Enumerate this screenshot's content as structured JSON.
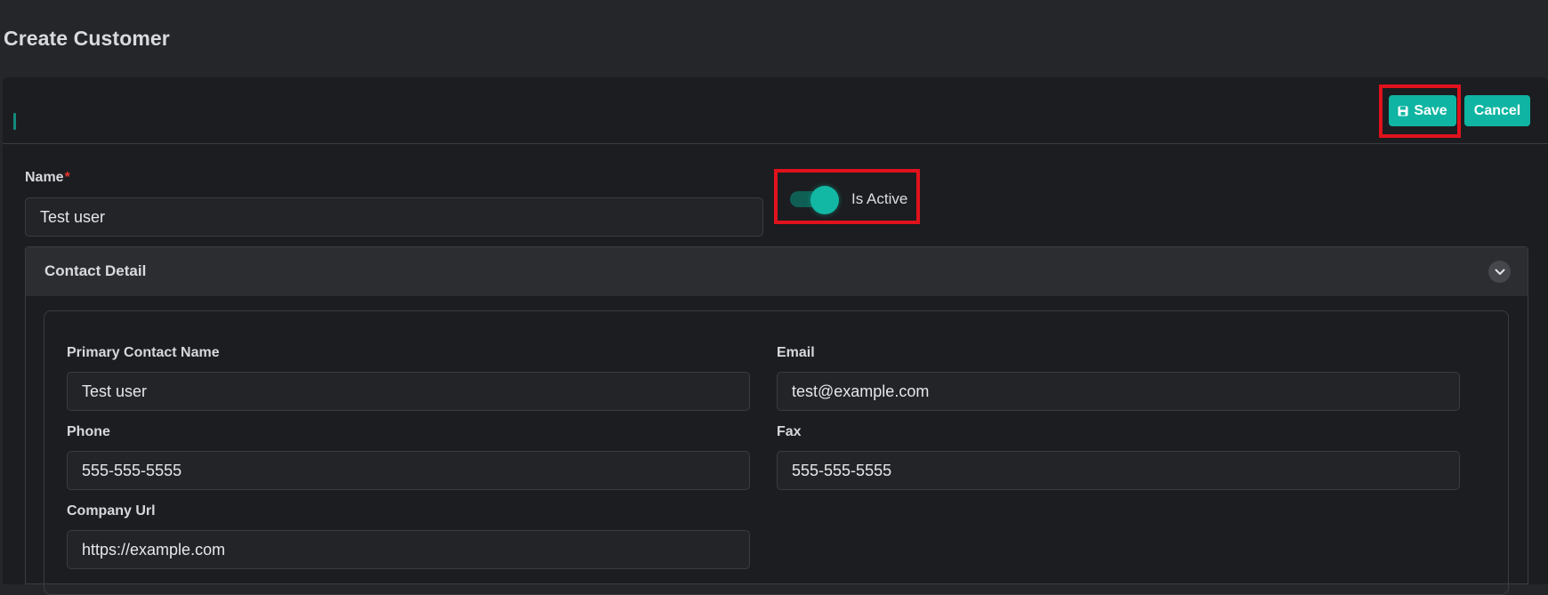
{
  "page": {
    "title": "Create Customer"
  },
  "toolbar": {
    "save_label": "Save",
    "cancel_label": "Cancel"
  },
  "form": {
    "name": {
      "label": "Name",
      "required_mark": "*",
      "value": "Test user"
    },
    "is_active": {
      "label": "Is Active",
      "checked": true
    }
  },
  "contact_detail": {
    "title": "Contact Detail",
    "expanded": true,
    "primary_contact_name": {
      "label": "Primary Contact Name",
      "value": "Test user"
    },
    "email": {
      "label": "Email",
      "value": "test@example.com"
    },
    "phone": {
      "label": "Phone",
      "value": "555-555-5555"
    },
    "fax": {
      "label": "Fax",
      "value": "555-555-5555"
    },
    "company_url": {
      "label": "Company Url",
      "value": "https://example.com"
    }
  },
  "icons": {
    "save": "floppy-disk-icon",
    "chevron": "chevron-down-icon"
  },
  "colors": {
    "accent": "#0fb5a2",
    "background": "#25262a",
    "card": "#1c1d20",
    "highlight": "#e0121c",
    "required": "#e2342c"
  }
}
